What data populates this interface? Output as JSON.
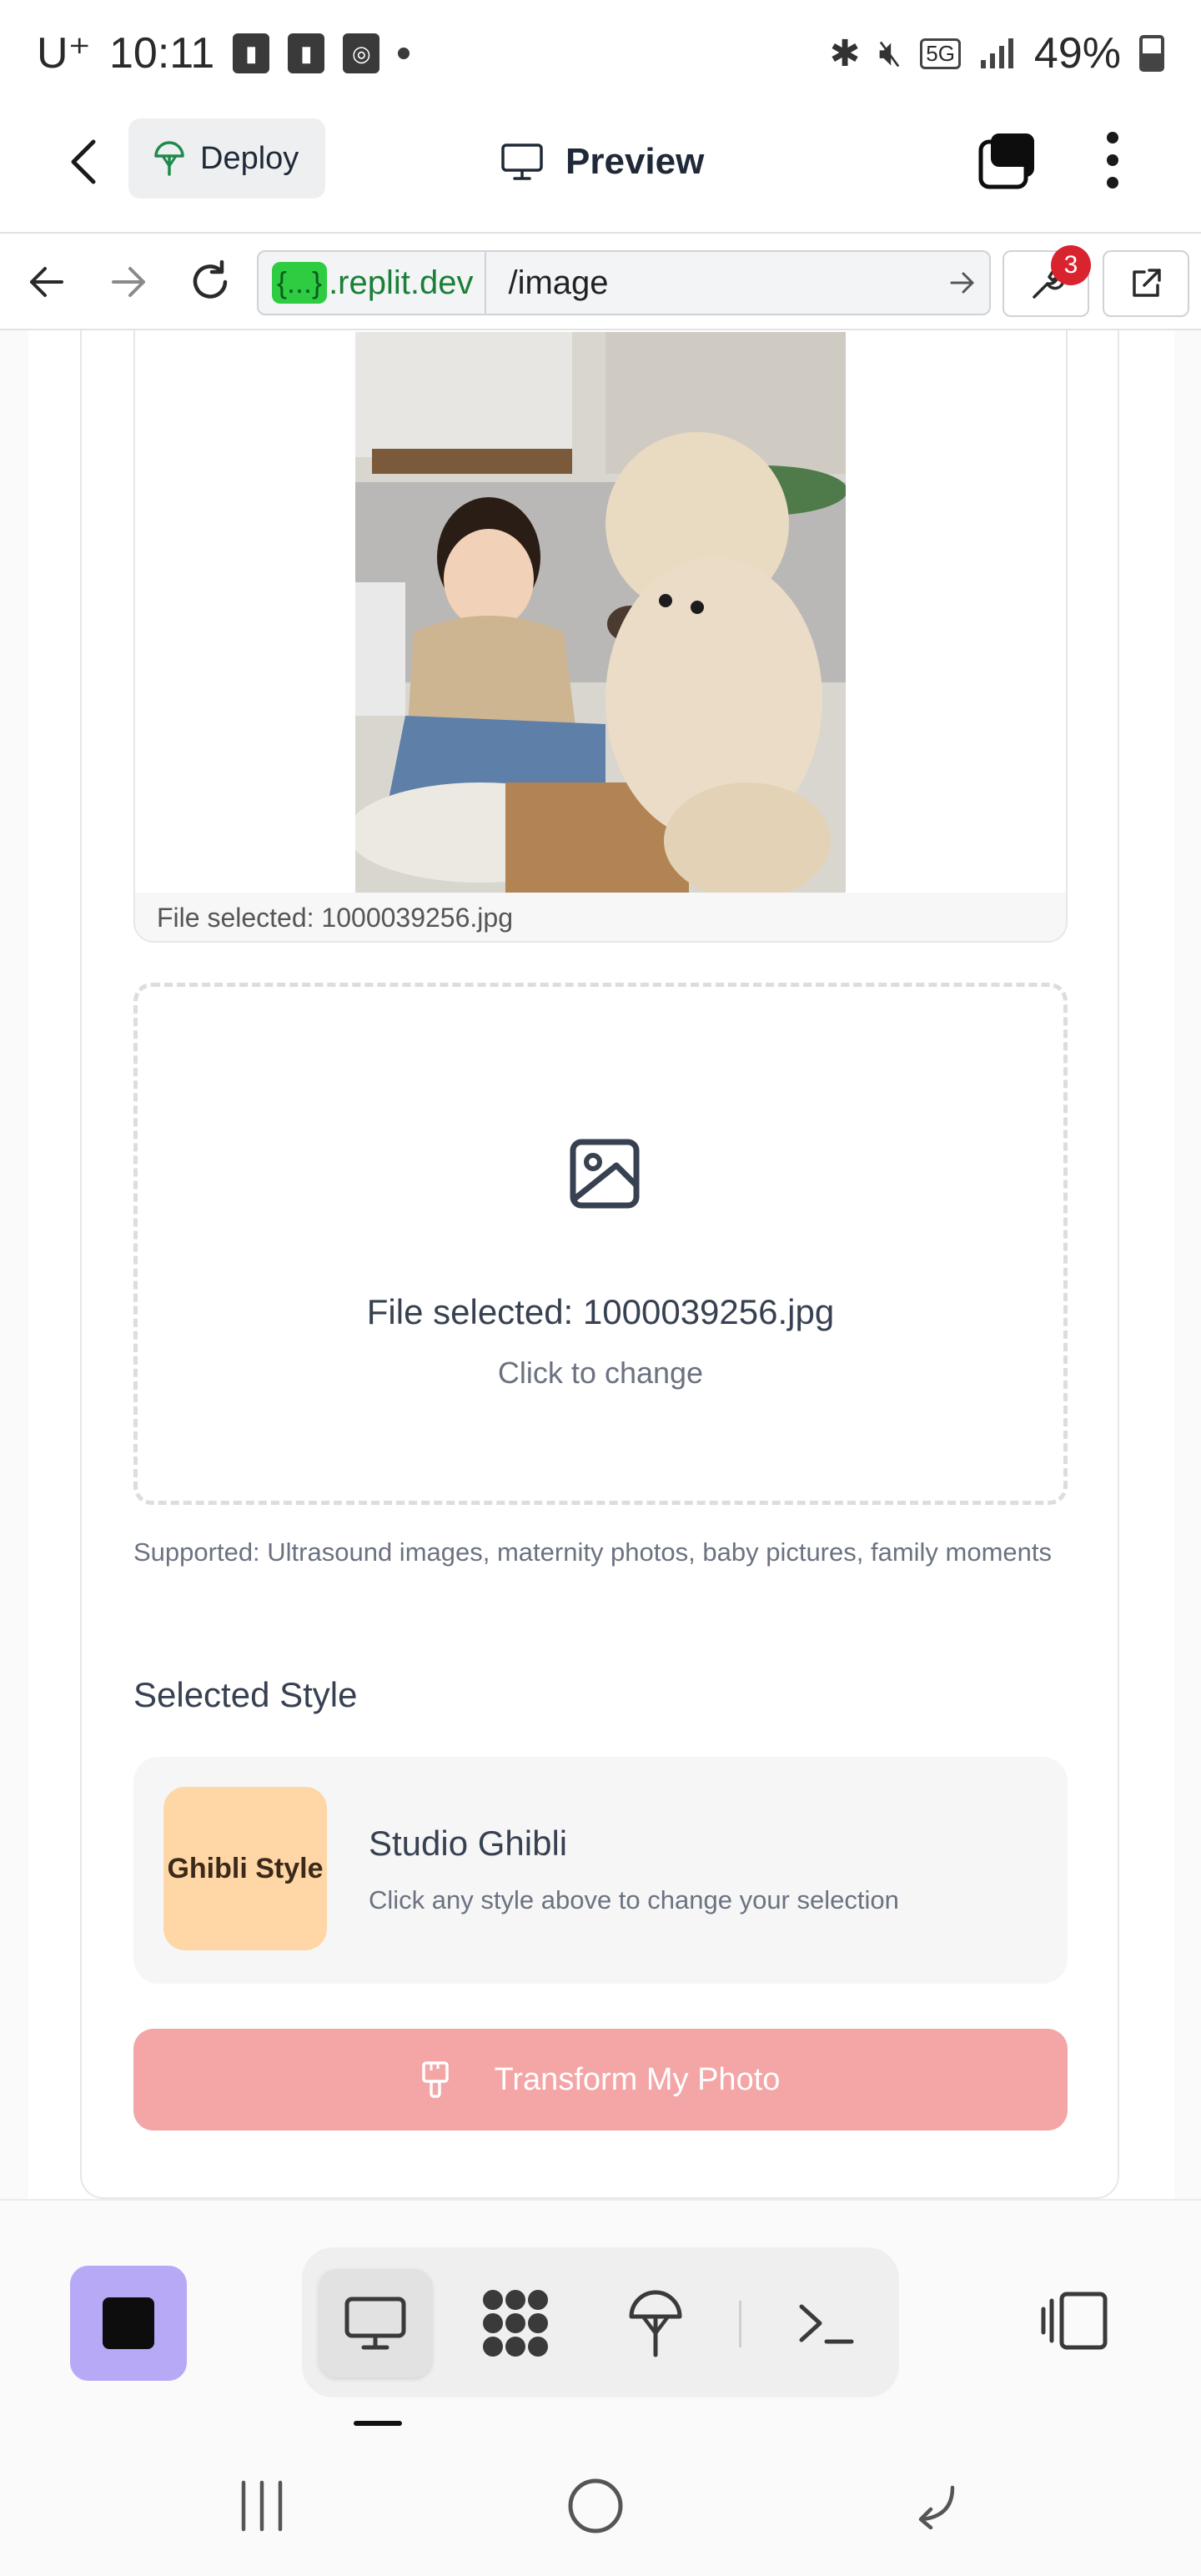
{
  "status_bar": {
    "carrier": "U⁺",
    "time": "10:11",
    "battery": "49%",
    "battery_level": 0.49,
    "network": "5G"
  },
  "header": {
    "deploy_label": "Deploy",
    "title": "Preview"
  },
  "url_bar": {
    "host_badge": "{...}",
    "host": ".replit.dev",
    "path": "/image",
    "notification_count": "3"
  },
  "preview_image": {
    "caption": "File selected: 1000039256.jpg"
  },
  "dropzone": {
    "title": "File selected: 1000039256.jpg",
    "subtitle": "Click to change"
  },
  "supported_text": "Supported: Ultrasound images, maternity photos, baby pictures, family moments",
  "selected_style": {
    "heading": "Selected Style",
    "thumb_label": "Ghibli Style",
    "name": "Studio Ghibli",
    "hint": "Click any style above to change your selection"
  },
  "transform_button": {
    "label": "Transform My Photo"
  },
  "colors": {
    "accent_purple": "#b8a9f7",
    "transform_button": "#f4a5a6",
    "style_thumb": "#ffd6a5",
    "url_badge": "#2ecc40"
  },
  "icons": {
    "toolbar": [
      "stop-icon",
      "monitor-icon",
      "agent-icon",
      "deploy-icon",
      "terminal-icon",
      "panel-icon"
    ],
    "nav": [
      "recent-apps-icon",
      "home-icon",
      "back-icon"
    ]
  }
}
